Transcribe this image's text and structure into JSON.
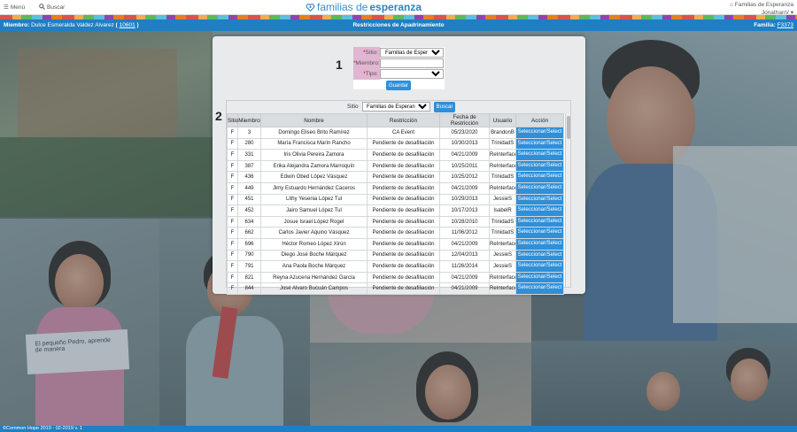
{
  "nav": {
    "menu_label": "Menú",
    "search_label": "Buscar",
    "logo_light": "familias de ",
    "logo_bold": "esperanza",
    "org": "Familias de Esperanza",
    "user": "JonathanV"
  },
  "subbar": {
    "member_prefix": "Miembro:",
    "member_name": "Dulce Esmeralda Valdez Alvarez",
    "member_id": "10601",
    "title": "Restricciones de Apadrinamiento",
    "family_prefix": "Familia:",
    "family_id": "F3373"
  },
  "form": {
    "step": "1",
    "sitio_label": "Sitio:",
    "sitio_value": "Familias de Esperanza",
    "miembro_label": "Miembro:",
    "miembro_value": "",
    "tipo_label": "Tipo:",
    "tipo_value": "",
    "guardar_label": "Guardar"
  },
  "table": {
    "step": "2",
    "sitio_label": "Sitio",
    "sitio_value": "Familias de Esperanza",
    "buscar_label": "Buscar",
    "columns": [
      "Sitio",
      "Miembro",
      "Nombre",
      "Restricción",
      "Fecha de Restricción",
      "Usuario",
      "Acción"
    ],
    "rows": [
      [
        "F",
        "3",
        "Domingo Eliseo Brito Ramírez",
        "CA Event",
        "05/23/2020",
        "BrandonB",
        "Seleccionar/Select"
      ],
      [
        "F",
        "280",
        "María Francisca Marín Rancho",
        "Pendiente de desafiliación",
        "10/30/2013",
        "TrinidadS",
        "Seleccionar/Select"
      ],
      [
        "F",
        "331",
        "Iris Olivia Pereira Zamora",
        "Pendiente de desafiliación",
        "04/21/2009",
        "ReInterface",
        "Seleccionar/Select"
      ],
      [
        "F",
        "387",
        "Erika Alejandra Zamora Marroquín",
        "Pendiente de desafiliación",
        "10/25/2011",
        "ReInterface",
        "Seleccionar/Select"
      ],
      [
        "F",
        "436",
        "Edwin Obed López Vásquez",
        "Pendiente de desafiliación",
        "10/25/2012",
        "TrinidadS",
        "Seleccionar/Select"
      ],
      [
        "F",
        "449",
        "Jimy Estuardo Hernández Caceros",
        "Pendiente de desafiliación",
        "04/21/2009",
        "ReInterface",
        "Seleccionar/Select"
      ],
      [
        "F",
        "451",
        "Lithy Yesenia López Tul",
        "Pendiente de desafiliación",
        "10/29/2013",
        "JessieS",
        "Seleccionar/Select"
      ],
      [
        "F",
        "452",
        "Jairo Samuel López Tul",
        "Pendiente de desafiliación",
        "10/17/2013",
        "IsabelR",
        "Seleccionar/Select"
      ],
      [
        "F",
        "634",
        "Josue Israel López Rogel",
        "Pendiente de desafiliación",
        "10/28/2010",
        "TrinidadS",
        "Seleccionar/Select"
      ],
      [
        "F",
        "662",
        "Carlos Javier Aquino Vásquez",
        "Pendiente de desafiliación",
        "11/06/2012",
        "TrinidadS",
        "Seleccionar/Select"
      ],
      [
        "F",
        "696",
        "Héctor Romeo López Xirún",
        "Pendiente de desafiliación",
        "04/21/2009",
        "ReInterface",
        "Seleccionar/Select"
      ],
      [
        "F",
        "790",
        "Diego José Boche Márquez",
        "Pendiente de desafiliación",
        "12/04/2013",
        "JessieS",
        "Seleccionar/Select"
      ],
      [
        "F",
        "791",
        "Ana Paola Boche Márquez",
        "Pendiente de desafiliación",
        "11/26/2014",
        "JessieS",
        "Seleccionar/Select"
      ],
      [
        "F",
        "821",
        "Reyna Azucena Hernández García",
        "Pendiente de desafiliación",
        "04/21/2009",
        "ReInterface",
        "Seleccionar/Select"
      ],
      [
        "F",
        "844",
        "José Alvaro Bucuán Campos",
        "Pendiente de desafiliación",
        "04/21/2009",
        "ReInterface",
        "Seleccionar/Select"
      ]
    ]
  },
  "background": {
    "sign_text": "El pequeño Pedro, aprende de manera"
  },
  "footer": {
    "text": "©Common Hope 2019 - 02-2019 v. 1"
  },
  "colors": {
    "brand_blue": "#1f7fc4",
    "button_blue": "#2f8fd8",
    "label_pink": "#e2b6d2"
  }
}
